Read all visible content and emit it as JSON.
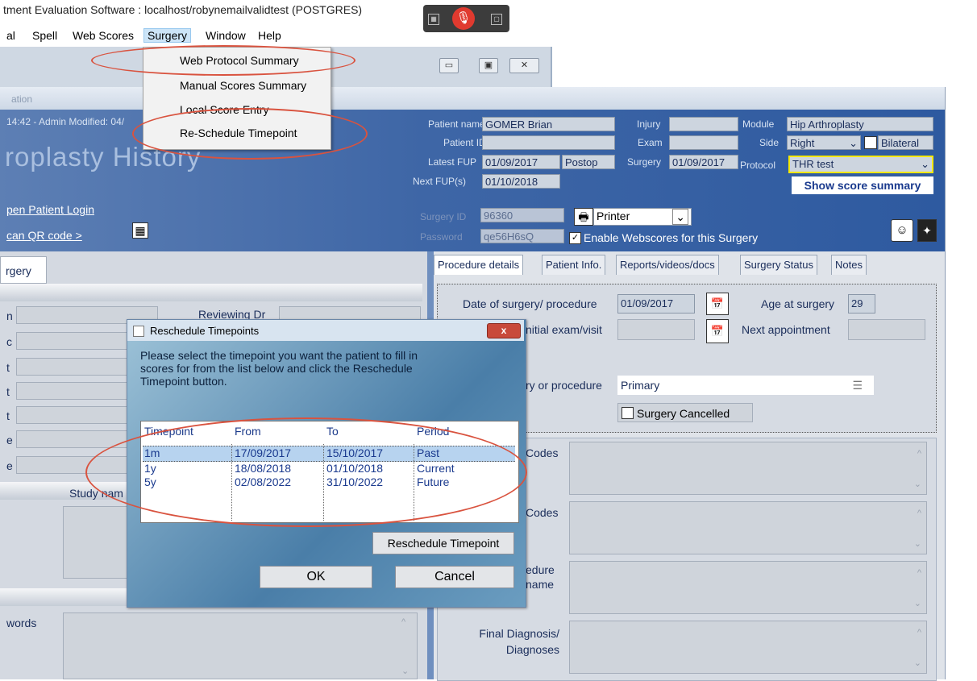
{
  "app": {
    "title": "tment Evaluation Software : localhost/robynemailvalidtest (POSTGRES)"
  },
  "menubar": [
    "al",
    "Spell",
    "Web Scores",
    "Surgery",
    "Window",
    "Help"
  ],
  "surgery_menu": [
    "Web Protocol Summary",
    "Manual Scores Summary",
    "Local Score Entry",
    "Re-Schedule Timepoint"
  ],
  "main": {
    "header_text": "ation",
    "admin_text": "14:42 - Admin Modified: 04/",
    "big_title": "roplasty History",
    "login_link": "pen Patient Login",
    "qr_link": "can QR code >",
    "surgery_tab": "rgery"
  },
  "patient": {
    "name_label": "Patient name",
    "name": "GOMER Brian",
    "id_label": "Patient ID",
    "id": "",
    "latest_label": "Latest FUP",
    "latest": "01/09/2017",
    "latest_tag": "Postop",
    "next_label": "Next FUP(s)",
    "next": "01/10/2018",
    "injury_label": "Injury",
    "exam_label": "Exam",
    "surgery_label": "Surgery",
    "surgery_date": "01/09/2017",
    "module_label": "Module",
    "module": "Hip Arthroplasty",
    "side_label": "Side",
    "side": "Right",
    "bilateral": "Bilateral",
    "protocol_label": "Protocol",
    "protocol": "THR test",
    "show_summary": "Show score summary",
    "surgery_id_label": "Surgery ID",
    "surgery_id": "96360",
    "password_label": "Password",
    "password": "qe56H6sQ",
    "printer": "Printer",
    "enable_webscores": "Enable Webscores for this Surgery"
  },
  "tabs": [
    "Procedure details",
    "Patient Info.",
    "Reports/videos/docs",
    "Surgery Status",
    "Notes"
  ],
  "procedure": {
    "date_label": "Date of surgery/ procedure",
    "date": "01/09/2017",
    "age_label": "Age at surgery",
    "age": "29",
    "initial_label": "nitial exam/visit",
    "next_appt_label": "Next appointment",
    "type_label": "ry or procedure",
    "type": "Primary",
    "cancelled": "Surgery Cancelled",
    "codes1": "Codes",
    "codes2": "Codes",
    "proc_name": "edure\nname",
    "final_diag": "Final Diagnosis/\nDiagnoses"
  },
  "left": {
    "reviewing_dr": "Reviewing Dr",
    "study_name": "Study nam",
    "keywords": "words",
    "letters": [
      "n",
      "c",
      "t",
      "t",
      "t",
      "e",
      "e"
    ]
  },
  "dialog": {
    "title": "Reschedule Timepoints",
    "close": "x",
    "message": "Please select the timepoint you want the patient to fill in scores for from the list below and click the Reschedule Timepoint button.",
    "columns": [
      "Timepoint",
      "From",
      "To",
      "Period"
    ],
    "rows": [
      [
        "1m",
        "17/09/2017",
        "15/10/2017",
        "Past"
      ],
      [
        "1y",
        "18/08/2018",
        "01/10/2018",
        "Current"
      ],
      [
        "5y",
        "02/08/2022",
        "31/10/2022",
        "Future"
      ]
    ],
    "reschedule_button": "Reschedule Timepoint",
    "ok": "OK",
    "cancel": "Cancel"
  },
  "colors": {
    "annotation": "#d9533f",
    "banner": "#3e66a6",
    "highlight": "#b7d3ef"
  }
}
